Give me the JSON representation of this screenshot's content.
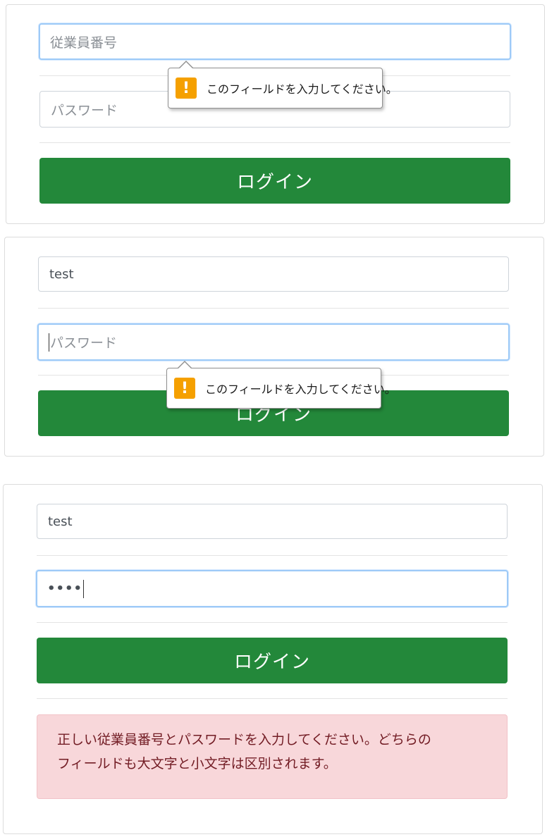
{
  "colors": {
    "button_green": "#23883a",
    "focus_border": "#9ecaf7",
    "warning_orange": "#f5a000",
    "alert_bg": "#f8d7da",
    "alert_text": "#721c24"
  },
  "panel1": {
    "employee_id": {
      "placeholder": "従業員番号",
      "value": ""
    },
    "password": {
      "placeholder": "パスワード",
      "value": ""
    },
    "tooltip": {
      "icon": "warning-icon",
      "text": "このフィールドを入力してください。"
    },
    "login_label": "ログイン"
  },
  "panel2": {
    "employee_id": {
      "placeholder": "従業員番号",
      "value": "test"
    },
    "password": {
      "placeholder": "パスワード",
      "value": ""
    },
    "tooltip": {
      "icon": "warning-icon",
      "text": "このフィールドを入力してください。"
    },
    "login_label": "ログイン"
  },
  "panel3": {
    "employee_id": {
      "placeholder": "従業員番号",
      "value": "test"
    },
    "password": {
      "placeholder": "パスワード",
      "masked_value": "••••"
    },
    "login_label": "ログイン",
    "error_line1": "正しい従業員番号とパスワードを入力してください。どちらの",
    "error_line2": "フィールドも大文字と小文字は区別されます。"
  }
}
